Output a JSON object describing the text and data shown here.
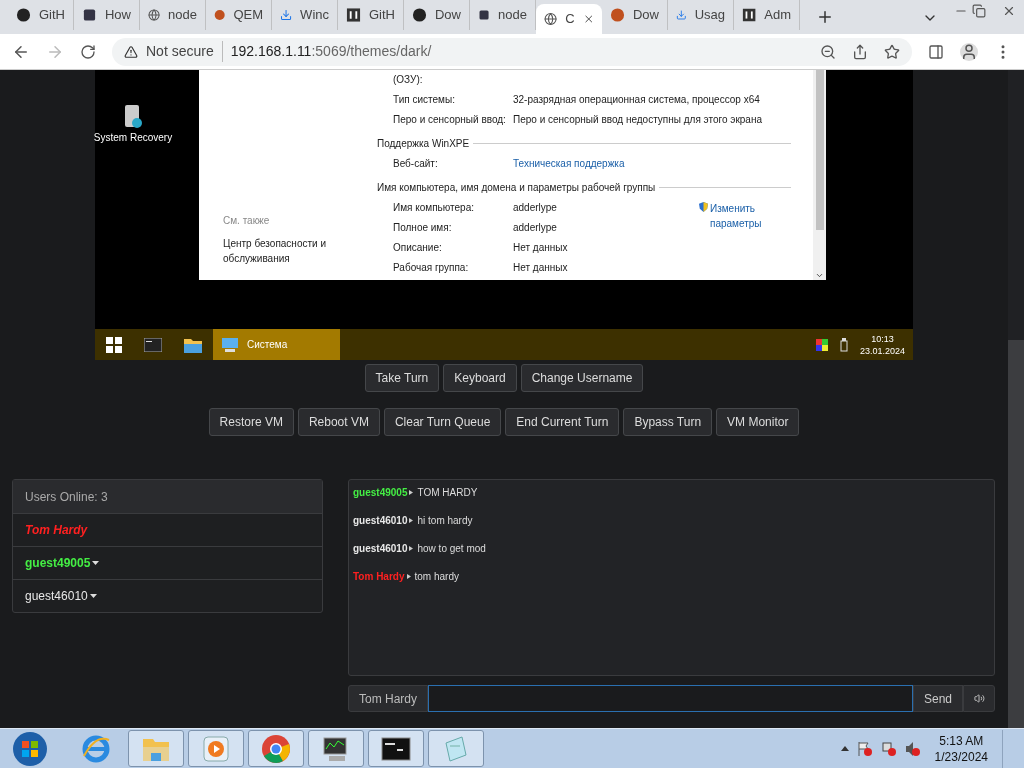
{
  "browser": {
    "tabs": [
      {
        "label": "GitH",
        "selected": false
      },
      {
        "label": "How",
        "selected": false
      },
      {
        "label": "node",
        "selected": false
      },
      {
        "label": "QEM",
        "selected": false
      },
      {
        "label": "Winc",
        "selected": false
      },
      {
        "label": "GitH",
        "selected": false
      },
      {
        "label": "Dow",
        "selected": false
      },
      {
        "label": "node",
        "selected": false
      },
      {
        "label": "C",
        "selected": true
      },
      {
        "label": "Dow",
        "selected": false
      },
      {
        "label": "Usag",
        "selected": false
      },
      {
        "label": "Adm",
        "selected": false
      }
    ],
    "security": "Not secure",
    "url_host": "192.168.1.11",
    "url_rest": ":5069/themes/dark/"
  },
  "vm": {
    "desktop_icons": [
      {
        "label": "System Recovery"
      }
    ],
    "window": {
      "see_also": "См. также",
      "see_also_link": "Центр безопасности и обслуживания",
      "top_rows": [
        {
          "label": "(ОЗУ):"
        },
        {
          "label": "Тип системы:",
          "value": "32-разрядная операционная система, процессор x64"
        },
        {
          "label": "Перо и сенсорный ввод:",
          "value": "Перо и сенсорный ввод недоступны для этого экрана"
        }
      ],
      "sections": [
        {
          "title": "Поддержка WinXPE",
          "rows": [
            {
              "label": "Веб-сайт:",
              "value": "Техническая поддержка",
              "kind": "link"
            }
          ]
        },
        {
          "title": "Имя компьютера, имя домена и параметры рабочей группы",
          "action": "Изменить параметры",
          "rows": [
            {
              "label": "Имя компьютера:",
              "value": "adderlype",
              "kind": "text"
            },
            {
              "label": "Полное имя:",
              "value": "adderlype",
              "kind": "text"
            },
            {
              "label": "Описание:",
              "value": "Нет данных",
              "kind": "text"
            },
            {
              "label": "Рабочая группа:",
              "value": "Нет данных",
              "kind": "text"
            }
          ]
        }
      ]
    },
    "taskbar": {
      "apps": [
        {
          "label": "Система",
          "selected": true
        }
      ],
      "time": "10:13",
      "date": "23.01.2024"
    }
  },
  "turn_controls": [
    "Take Turn",
    "Keyboard",
    "Change Username"
  ],
  "admin_controls": [
    "Restore VM",
    "Reboot VM",
    "Clear Turn Queue",
    "End Current Turn",
    "Bypass Turn",
    "VM Monitor"
  ],
  "users": {
    "header": "Users Online: 3",
    "items": [
      {
        "name": "Tom Hardy",
        "color": "#ff2020",
        "kind": "self",
        "bold": true
      },
      {
        "name": "guest49005",
        "color": "#44ee44",
        "kind": "other",
        "bold": true
      },
      {
        "name": "guest46010",
        "color": "#e8e8e8",
        "kind": "other",
        "bold": false
      }
    ]
  },
  "chat": {
    "messages": [
      {
        "user": "guest49005",
        "color": "#44ee44",
        "text": "TOM HARDY"
      },
      {
        "user": "guest46010",
        "color": "#e8e8e8",
        "text": "hi tom hardy"
      },
      {
        "user": "guest46010",
        "color": "#e8e8e8",
        "text": "how to get mod"
      },
      {
        "user": "Tom Hardy",
        "color": "#ff2020",
        "text": "tom hardy"
      }
    ],
    "username": "Tom Hardy",
    "send": "Send"
  },
  "os_taskbar": {
    "apps": [
      {
        "running": false
      },
      {
        "running": true
      },
      {
        "running": true
      },
      {
        "running": true
      },
      {
        "running": true
      },
      {
        "running": true
      },
      {
        "running": true
      }
    ],
    "time": "5:13 AM",
    "date": "1/23/2024"
  }
}
